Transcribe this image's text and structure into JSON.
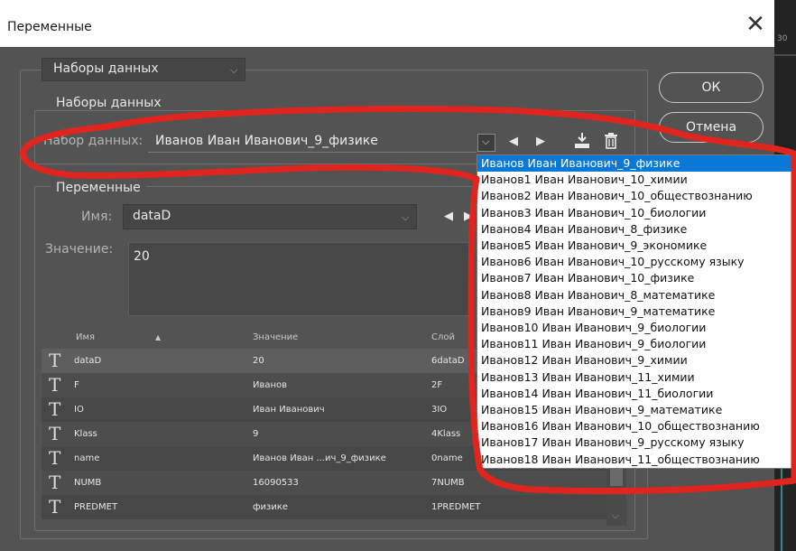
{
  "window": {
    "title": "Переменные",
    "close_glyph": "✕",
    "right_ruler": "30"
  },
  "top_dropdown": {
    "value": "Наборы данных"
  },
  "datasets_group": {
    "legend": "Наборы данных",
    "label": "Набор данных:",
    "value": "Иванов Иван Иванович_9_физике"
  },
  "buttons": {
    "ok": "ОК",
    "cancel": "Отмена"
  },
  "variables_group": {
    "legend": "Переменные",
    "name_label": "Имя:",
    "name_value": "dataD",
    "value_label": "Значение:",
    "value_text": "20"
  },
  "table": {
    "headers": {
      "name": "Имя",
      "sort_icon": "▲",
      "value": "Значение",
      "layer": "Слой"
    },
    "rows": [
      {
        "icon": "T",
        "name": "dataD",
        "value": "20",
        "layer": "6dataD"
      },
      {
        "icon": "T",
        "name": "F",
        "value": "Иванов",
        "layer": "2F"
      },
      {
        "icon": "T",
        "name": "IO",
        "value": "Иван Иванович",
        "layer": "3IO"
      },
      {
        "icon": "T",
        "name": "Klass",
        "value": "9",
        "layer": "4Klass"
      },
      {
        "icon": "T",
        "name": "name",
        "value": "Иванов Иван ...ич_9_физике",
        "layer": "0name"
      },
      {
        "icon": "T",
        "name": "NUMB",
        "value": "16090533",
        "layer": "7NUMB"
      },
      {
        "icon": "T",
        "name": "PREDMET",
        "value": "физике",
        "layer": "1PREDMET"
      }
    ]
  },
  "dataset_list": {
    "selected_index": 0,
    "items": [
      "Иванов Иван Иванович_9_физике",
      "Иванов1 Иван Иванович_10_химии",
      "Иванов2 Иван Иванович_10_обществознанию",
      "Иванов3 Иван Иванович_10_биологии",
      "Иванов4 Иван Иванович_8_физике",
      "Иванов5 Иван Иванович_9_экономике",
      "Иванов6 Иван Иванович_10_русскому языку",
      "Иванов7 Иван Иванович_10_физике",
      "Иванов8 Иван Иванович_8_математике",
      "Иванов9 Иван Иванович_9_математике",
      "Иванов10 Иван Иванович_9_биологии",
      "Иванов11 Иван Иванович_9_биологии",
      "Иванов12 Иван Иванович_9_химии",
      "Иванов13 Иван Иванович_11_химии",
      "Иванов14 Иван Иванович_11_биологии",
      "Иванов15 Иван Иванович_9_математике",
      "Иванов16 Иван Иванович_10_обществознанию",
      "Иванов17 Иван Иванович_9_русскому языку",
      "Иванов18 Иван Иванович_11_обществознанию"
    ]
  },
  "icons": {
    "close": "close-icon",
    "dropdown": "chevron-down-icon",
    "prev": "arrow-left-icon",
    "next": "arrow-right-icon",
    "import": "import-icon",
    "delete": "trash-icon",
    "text_layer": "text-layer-icon"
  },
  "colors": {
    "dialog_bg": "#535353",
    "selection": "#0a78d7",
    "annotation_red": "#e0241e"
  }
}
